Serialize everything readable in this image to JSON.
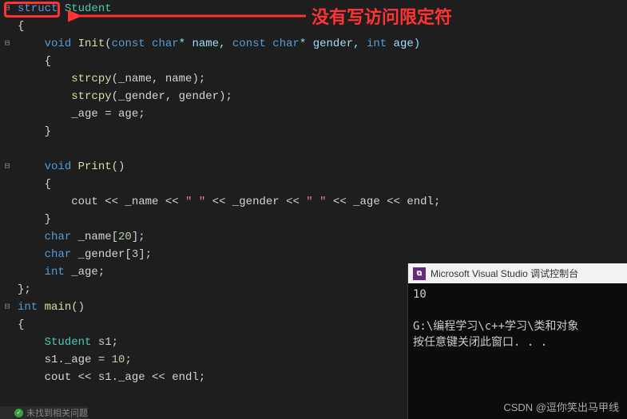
{
  "annotation": "没有写访问限定符",
  "code": {
    "l1_struct": "struct",
    "l1_name": " Student",
    "l2": "{",
    "l3_void": "void",
    "l3_fn": " Init",
    "l3_p1": "(",
    "l3_const1": "const",
    "l3_char1": " char",
    "l3_name": "* name, ",
    "l3_const2": "const",
    "l3_char2": " char",
    "l3_gender": "* gender, ",
    "l3_int": "int",
    "l3_age": " age)",
    "l4": "{",
    "l5_fn": "strcpy",
    "l5_args": "(_name, name);",
    "l6_fn": "strcpy",
    "l6_args": "(_gender, gender);",
    "l7": "_age = age;",
    "l8": "}",
    "l9": "",
    "l10_void": "void",
    "l10_fn": " Print",
    "l10_p": "()",
    "l11": "{",
    "l12a": "cout << _name << ",
    "l12s1": "\" \"",
    "l12b": " << _gender << ",
    "l12s2": "\" \"",
    "l12c": " << _age << endl;",
    "l13": "}",
    "l14_char": "char",
    "l14_rest": " _name[",
    "l14_num": "20",
    "l14_end": "];",
    "l15_char": "char",
    "l15_rest": " _gender[",
    "l15_num": "3",
    "l15_end": "];",
    "l16_int": "int",
    "l16_rest": " _age;",
    "l17": "};",
    "l18_int": "int",
    "l18_fn": " main",
    "l18_p": "()",
    "l19": "{",
    "l20_type": "Student",
    "l20_rest": " s1;",
    "l21a": "s1._age = ",
    "l21_num": "10",
    "l21b": ";",
    "l22": "cout << s1._age << endl;"
  },
  "console": {
    "title": "Microsoft Visual Studio 调试控制台",
    "out1": "10",
    "out2": "G:\\编程学习\\c++学习\\类和对象",
    "out3": "按任意键关闭此窗口. . ."
  },
  "watermark": "CSDN @逗你笑出马甲线",
  "status": "未找到相关问题"
}
